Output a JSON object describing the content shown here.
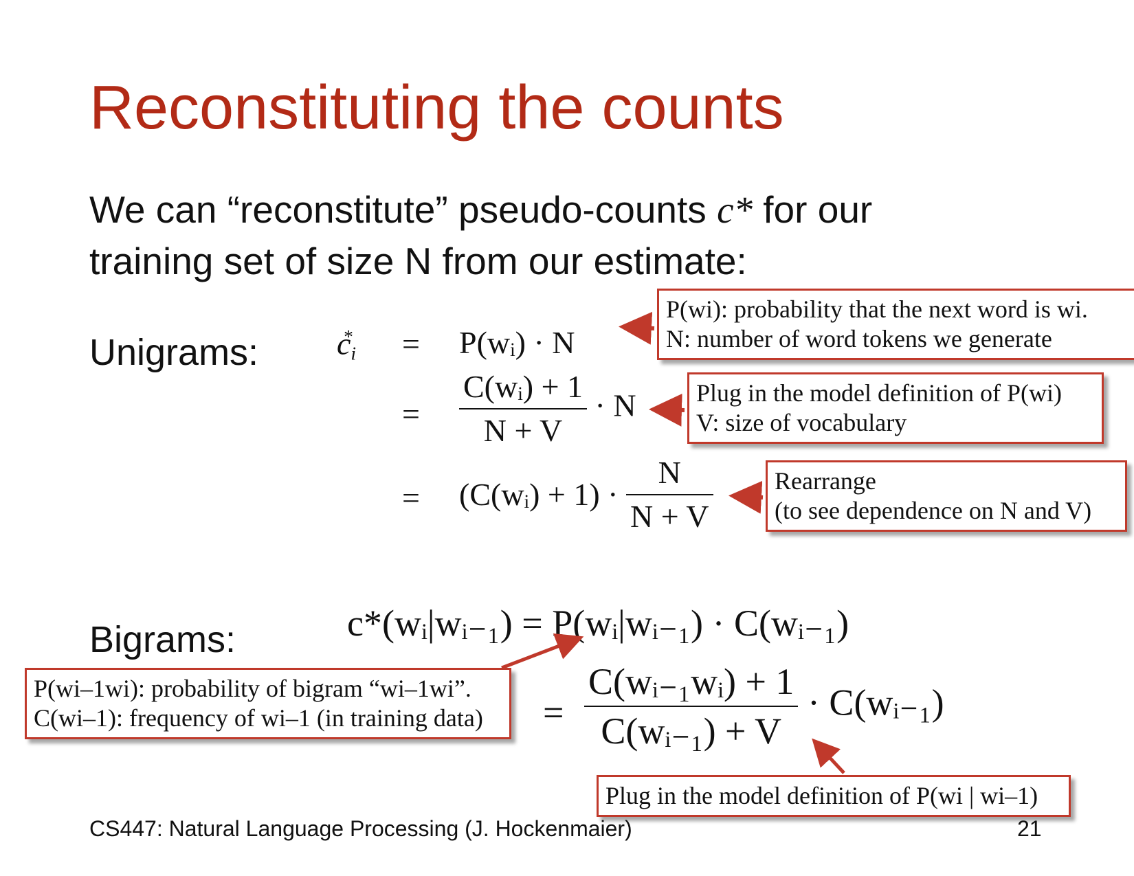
{
  "title": "Reconstituting the counts",
  "intro": {
    "line1_a": "We can “reconstitute” pseudo-counts ",
    "line1_sym": "c*",
    "line1_b": " for our",
    "line2": "training set of size N from our estimate:"
  },
  "unigrams": {
    "label": "Unigrams:",
    "eq_sign": "=",
    "row1_rhs": "P(wᵢ) · N",
    "row2_num": "C(wᵢ) + 1",
    "row2_den": "N + V",
    "row2_tail": "· N",
    "row3_head": "(C(wᵢ) + 1) ·",
    "row3_num": "N",
    "row3_den": "N + V"
  },
  "bigrams": {
    "label": "Bigrams:",
    "row1_lhs": "c*(wᵢ|wᵢ₋₁)",
    "row1_rhs": "P(wᵢ|wᵢ₋₁) · C(wᵢ₋₁)",
    "row2_num": "C(wᵢ₋₁wᵢ) + 1",
    "row2_den": "C(wᵢ₋₁) + V",
    "row2_tail": "· C(wᵢ₋₁)"
  },
  "annotations": {
    "box1": {
      "line1": "P(wi): probability that the next word is wi.",
      "line2": "N: number of word tokens we generate"
    },
    "box2": {
      "line1": "Plug in the model definition of P(wi)",
      "line2": "V: size of vocabulary"
    },
    "box3": {
      "line1": "Rearrange",
      "line2": "(to see dependence on N and V)"
    },
    "box4": {
      "line1": "P(wi–1wi): probability of bigram “wi–1wi”.",
      "line2": "C(wi–1): frequency of wi–1 (in training data)"
    },
    "box5": {
      "line1": "Plug in the model definition of P(wi | wi–1)"
    }
  },
  "footer": {
    "course": "CS447: Natural Language Processing (J. Hockenmaier)",
    "page": "21"
  },
  "colors": {
    "title": "#b22a16",
    "annotation_border": "#c0392b",
    "arrow": "#c0392b"
  }
}
